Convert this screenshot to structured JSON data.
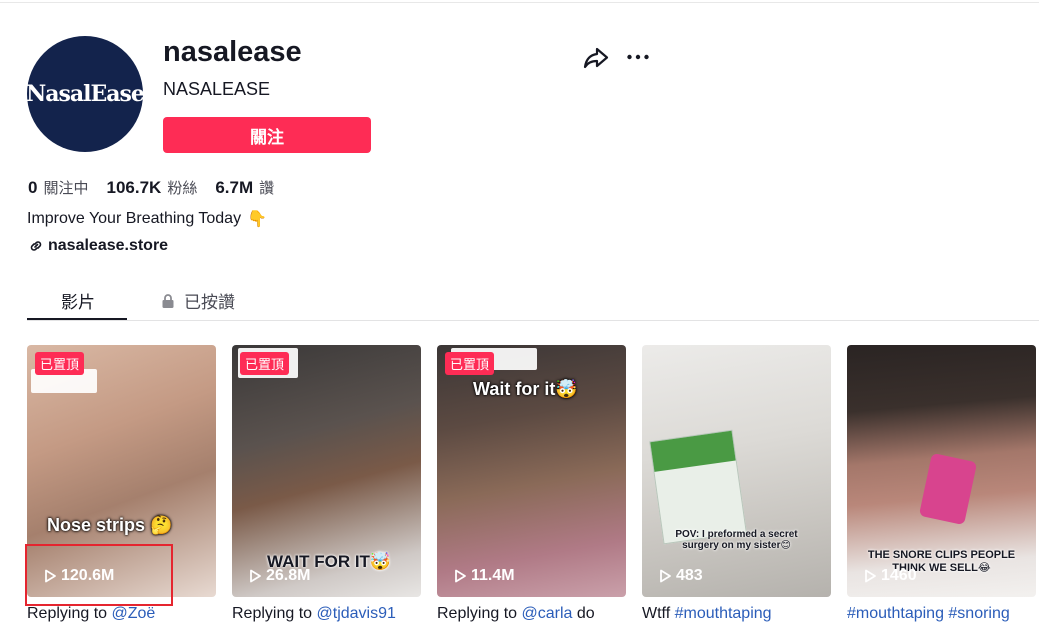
{
  "profile": {
    "avatar_text": "NasalEase",
    "username": "nasalease",
    "nickname": "NASALEASE",
    "follow_label": "關注",
    "stats": {
      "following_count": "0",
      "following_label": "關注中",
      "followers_count": "106.7K",
      "followers_label": "粉絲",
      "likes_count": "6.7M",
      "likes_label": "讚"
    },
    "bio": "Improve Your Breathing Today",
    "bio_emoji": "👇",
    "link": "nasalease.store"
  },
  "icons": {
    "share": "share-icon",
    "more": "more-icon",
    "link": "link-icon",
    "lock": "lock-icon",
    "play": "play-icon"
  },
  "tabs": {
    "videos": "影片",
    "liked": "已按讚"
  },
  "videos": [
    {
      "pinned": "已置頂",
      "overlay": "Nose strips 🤔",
      "views": "120.6M",
      "desc_plain": "Replying to ",
      "desc_tag": "@Zoë",
      "desc_tail": ""
    },
    {
      "pinned": "已置頂",
      "overlay": "WAIT FOR IT🤯",
      "views": "26.8M",
      "desc_plain": "Replying to ",
      "desc_tag": "@tjdavis91",
      "desc_tail": ""
    },
    {
      "pinned": "已置頂",
      "overlay": "Wait for it🤯",
      "views": "11.4M",
      "desc_plain": "Replying to ",
      "desc_tag": "@carla",
      "desc_tail": " do"
    },
    {
      "pinned": "",
      "overlay": "POV: I preformed a secret surgery on my sister😊",
      "views": "483",
      "desc_plain": "Wtff ",
      "desc_tag": "#mouthtaping",
      "desc_tail": ""
    },
    {
      "pinned": "",
      "overlay": "THE SNORE CLIPS PEOPLE THINK WE SELL😂",
      "views": "1460",
      "desc_plain": "",
      "desc_tag": "#mouthtaping #snoring",
      "desc_tail": ""
    }
  ],
  "colors": {
    "brand_red": "#fe2c55",
    "avatar_bg": "#13234c",
    "hashtag_blue": "#2b5db9"
  }
}
